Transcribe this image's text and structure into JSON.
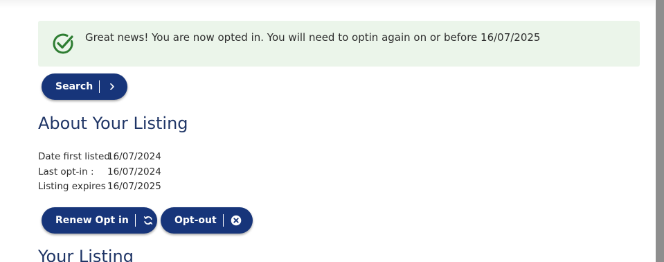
{
  "alert": {
    "message": "Great news! You are now opted in. You will need to optin again on or before 16/07/2025",
    "icon": "check-circle-icon",
    "icon_color": "#2e7d32",
    "background": "#ebf5ea"
  },
  "search_button": {
    "label": "Search",
    "icon": "chevron-right-icon"
  },
  "about": {
    "heading": "About Your Listing",
    "details": [
      {
        "label": "Date first listed :",
        "value": "16/07/2024"
      },
      {
        "label": "Last opt-in :",
        "value": "16/07/2024"
      },
      {
        "label": "Listing expires :",
        "value": "16/07/2025"
      }
    ]
  },
  "actions": {
    "renew_label": "Renew Opt in",
    "renew_icon": "refresh-icon",
    "optout_label": "Opt-out",
    "optout_icon": "close-circle-icon"
  },
  "your_listing": {
    "heading": "Your Listing"
  },
  "colors": {
    "button": "#17357a",
    "heading": "#1f3566"
  }
}
